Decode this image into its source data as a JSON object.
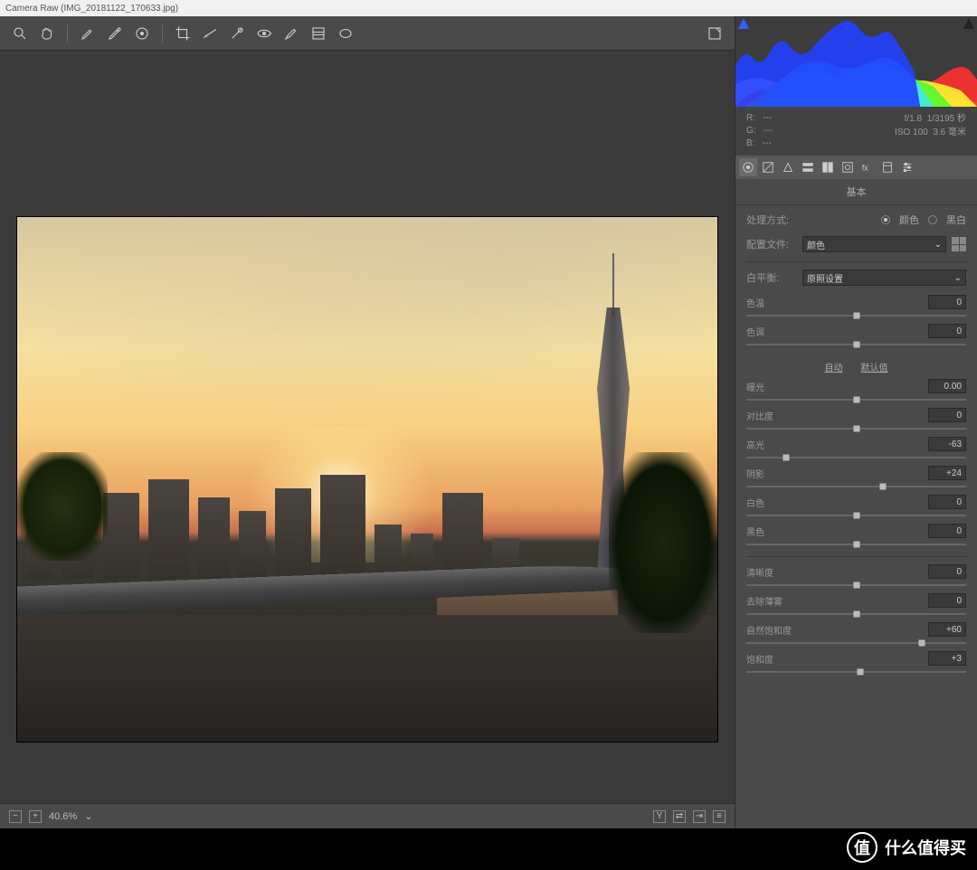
{
  "titlebar": "Camera Raw (IMG_20181122_170633.jpg)",
  "zoom": "40.6%",
  "metadata": {
    "r_label": "R:",
    "r_val": "---",
    "g_label": "G:",
    "g_val": "---",
    "b_label": "B:",
    "b_val": "---",
    "aperture": "f/1.8",
    "shutter": "1/3195 秒",
    "iso": "ISO 100",
    "focal": "3.6 毫米"
  },
  "section_title": "基本",
  "treatment": {
    "label": "处理方式:",
    "opt1": "颜色",
    "opt2": "黑白"
  },
  "profile": {
    "label": "配置文件:",
    "value": "颜色"
  },
  "wb": {
    "label": "白平衡:",
    "value": "原照设置"
  },
  "links": {
    "auto": "自动",
    "default": "默认值"
  },
  "sliders": {
    "temp": {
      "label": "色温",
      "value": "0",
      "pos": 50
    },
    "tint": {
      "label": "色调",
      "value": "0",
      "pos": 50
    },
    "exposure": {
      "label": "曝光",
      "value": "0.00",
      "pos": 50
    },
    "contrast": {
      "label": "对比度",
      "value": "0",
      "pos": 50
    },
    "highlights": {
      "label": "高光",
      "value": "-63",
      "pos": 18
    },
    "shadows": {
      "label": "阴影",
      "value": "+24",
      "pos": 62
    },
    "whites": {
      "label": "白色",
      "value": "0",
      "pos": 50
    },
    "blacks": {
      "label": "黑色",
      "value": "0",
      "pos": 50
    },
    "clarity": {
      "label": "清晰度",
      "value": "0",
      "pos": 50
    },
    "dehaze": {
      "label": "去除薄雾",
      "value": "0",
      "pos": 50
    },
    "vibrance": {
      "label": "自然饱和度",
      "value": "+60",
      "pos": 80
    },
    "saturation": {
      "label": "饱和度",
      "value": "+3",
      "pos": 52
    }
  },
  "watermark": {
    "badge": "值",
    "text": "什么值得买"
  }
}
